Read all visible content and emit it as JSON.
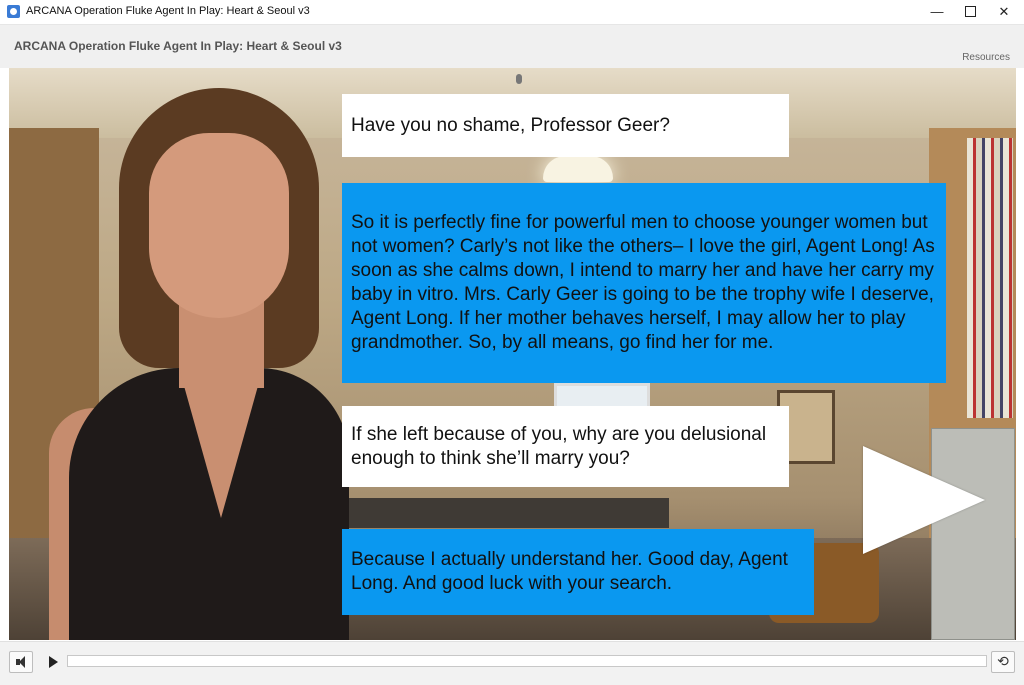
{
  "window": {
    "title": "ARCANA Operation Fluke Agent In Play: Heart & Seoul v3",
    "minimize_glyph": "—",
    "close_glyph": "✕"
  },
  "header": {
    "title": "ARCANA Operation Fluke Agent In Play: Heart & Seoul v3",
    "resources_label": "Resources"
  },
  "dialogue": [
    {
      "text": "Have you no shame, Professor Geer?",
      "style": "white"
    },
    {
      "text": "So it is perfectly fine for powerful men to choose younger women but not women?  Carly’s not like the others– I love the girl, Agent Long!  As soon as she calms down, I intend to marry her and have her carry my baby in vitro.  Mrs. Carly Geer is going to be the trophy wife I deserve, Agent Long.  If her mother behaves herself, I may allow her to play grandmother.  So, by all means, go find her for me.",
      "style": "blue"
    },
    {
      "text": "If she left because of you, why are you delusional enough to think she’ll marry you?",
      "style": "white"
    },
    {
      "text": "Because I actually understand her.  Good day, Agent Long.  And good luck with your search.",
      "style": "blue"
    }
  ],
  "controls": {
    "progress_fraction": 0.0,
    "replay_glyph": "⟲",
    "icons": [
      "speaker-icon",
      "play-icon",
      "replay-icon"
    ]
  },
  "colors": {
    "dialog_blue": "#0a98f0",
    "dialog_white": "#ffffff",
    "header_bg": "#f0f0f0"
  }
}
